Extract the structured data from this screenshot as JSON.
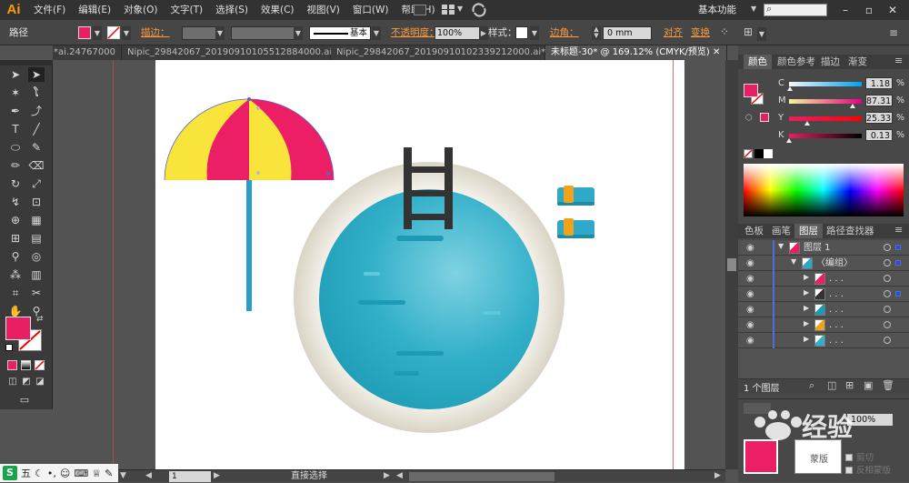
{
  "app": {
    "logo": "Ai",
    "workspace": "基本功能"
  },
  "menu": [
    "文件(F)",
    "编辑(E)",
    "对象(O)",
    "文字(T)",
    "选择(S)",
    "效果(C)",
    "视图(V)",
    "窗口(W)",
    "帮助(H)"
  ],
  "control": {
    "object_type": "路径",
    "stroke_label": "描边：",
    "stroke_style": "基本",
    "opacity_label": "不透明度：",
    "opacity_value": "100%",
    "style_label": "样式：",
    "corner_label": "边角：",
    "corner_value": "0 mm",
    "align_label": "对齐",
    "transform_label": "变换"
  },
  "tabs": [
    {
      "label": "24767000.ai*",
      "active": false
    },
    {
      "label": "Nipic_29842067_20190910105512884000.ai*",
      "active": false
    },
    {
      "label": "Nipic_29842067_20190910102339212000.ai*",
      "active": false
    },
    {
      "label": "未标题-30* @ 169.12% (CMYK/预览)",
      "active": true
    }
  ],
  "color_panel": {
    "tabs": [
      "颜色",
      "颜色参考",
      "描边",
      "渐变"
    ],
    "sliders": [
      {
        "channel": "C",
        "value": "1.18",
        "pct": 0.0118,
        "gradient": "linear-gradient(to right,#f7f7f7,#00a0e9)"
      },
      {
        "channel": "M",
        "value": "87.31",
        "pct": 0.8731,
        "gradient": "linear-gradient(to right,#f5f5a0,#e4007f)"
      },
      {
        "channel": "Y",
        "value": "25.33",
        "pct": 0.2533,
        "gradient": "linear-gradient(to right,#e91e63,#ff0000)"
      },
      {
        "channel": "K",
        "value": "0.13",
        "pct": 0.0013,
        "gradient": "linear-gradient(to right,#e91e63,#000)"
      }
    ],
    "percent": "%",
    "fill_color": "#e91e63"
  },
  "layers_panel": {
    "tabs": [
      "色板",
      "画笔",
      "图层",
      "路径查找器"
    ],
    "rows": [
      {
        "name": "图层 1",
        "indent": 0,
        "expand": "▼"
      },
      {
        "name": "〈编组〉",
        "indent": 1,
        "expand": "▼"
      },
      {
        "name": ". . .",
        "indent": 2,
        "expand": "▶"
      },
      {
        "name": ". . .",
        "indent": 2,
        "expand": "▶"
      },
      {
        "name": ". . .",
        "indent": 2,
        "expand": "▶"
      },
      {
        "name": ". . .",
        "indent": 2,
        "expand": "▶"
      },
      {
        "name": ". . .",
        "indent": 2,
        "expand": "▶"
      }
    ],
    "footer": "1 个图层"
  },
  "transparency_panel": {
    "opacity_value": "100%",
    "option1": "剪切",
    "option2": "反相蒙版",
    "mask_label": "蒙版"
  },
  "status": {
    "zoom": "169.12%",
    "page": "1",
    "tool": "直接选择"
  },
  "ime": {
    "label": "五"
  },
  "watermark": "经验"
}
